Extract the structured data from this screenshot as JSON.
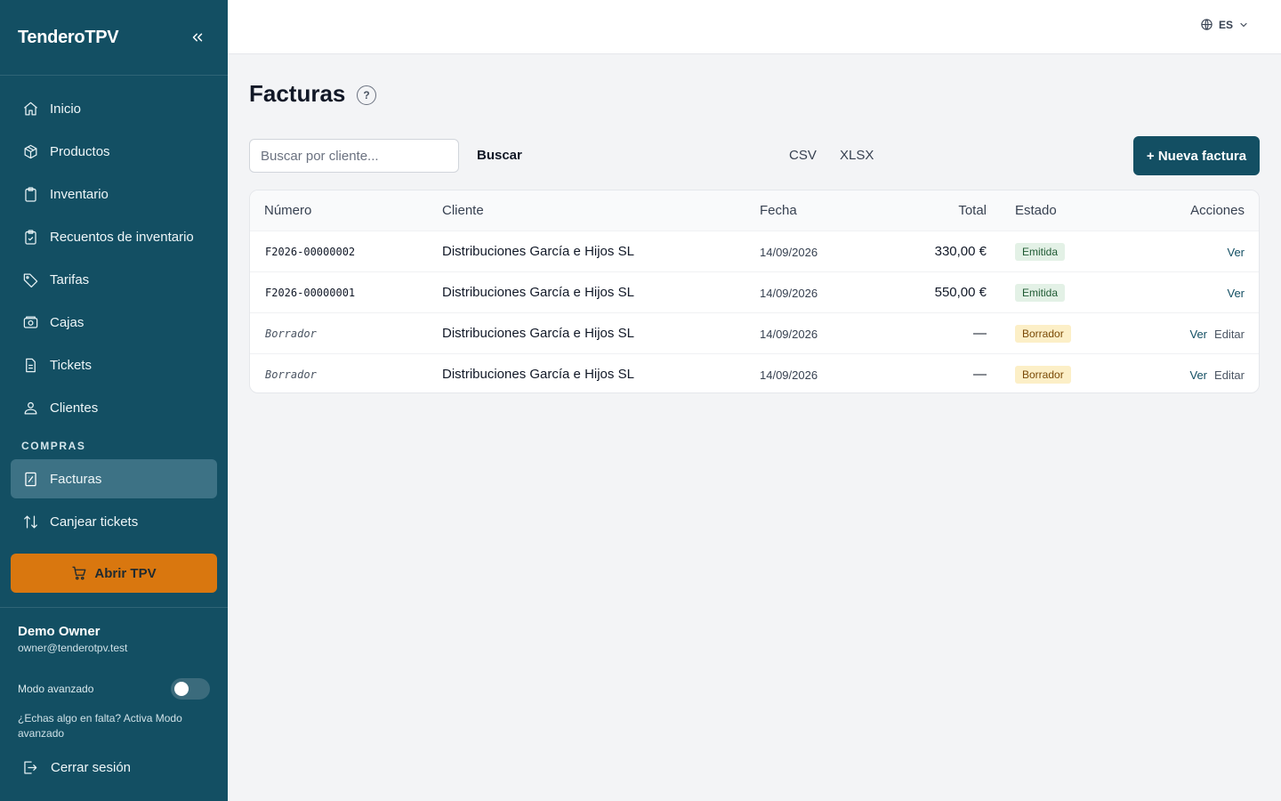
{
  "app": {
    "brand": "TenderoTPV",
    "language": "ES"
  },
  "sidebar": {
    "items": [
      {
        "label": "Inicio",
        "icon": "home-icon"
      },
      {
        "label": "Productos",
        "icon": "box-icon"
      },
      {
        "label": "Inventario",
        "icon": "clipboard-icon"
      },
      {
        "label": "Recuentos de inventario",
        "icon": "clipboard-check-icon"
      },
      {
        "label": "Tarifas",
        "icon": "tag-icon"
      },
      {
        "label": "Cajas",
        "icon": "cash-register-icon"
      },
      {
        "label": "Tickets",
        "icon": "document-icon"
      },
      {
        "label": "Clientes",
        "icon": "users-icon"
      }
    ],
    "section_label": "COMPRAS",
    "section_items": [
      {
        "label": "Facturas",
        "icon": "invoice-icon",
        "active": true
      },
      {
        "label": "Canjear tickets",
        "icon": "arrows-swap-icon"
      }
    ],
    "open_tpv": "Abrir TPV",
    "user": {
      "name": "Demo Owner",
      "email": "owner@tenderotpv.test"
    },
    "advanced_mode_label": "Modo avanzado",
    "advanced_mode_on": false,
    "advanced_hint": "¿Echas algo en falta? Activa Modo avanzado",
    "logout": "Cerrar sesión"
  },
  "main": {
    "title": "Facturas",
    "help_glyph": "?",
    "search_placeholder": "Buscar por cliente...",
    "search_button": "Buscar",
    "export_csv": "CSV",
    "export_xlsx": "XLSX",
    "new_invoice": "+ Nueva factura",
    "table": {
      "headers": {
        "number": "Número",
        "client": "Cliente",
        "date": "Fecha",
        "total": "Total",
        "status": "Estado",
        "actions": "Acciones"
      },
      "rows": [
        {
          "number": "F2026-00000002",
          "client": "Distribuciones García e Hijos SL",
          "date": "14/09/2026",
          "total": "330,00 €",
          "status": "Emitida",
          "view": "Ver",
          "edit": ""
        },
        {
          "number": "F2026-00000001",
          "client": "Distribuciones García e Hijos SL",
          "date": "14/09/2026",
          "total": "550,00 €",
          "status": "Emitida",
          "view": "Ver",
          "edit": ""
        },
        {
          "number": "Borrador",
          "client": "Distribuciones García e Hijos SL",
          "date": "14/09/2026",
          "total": "—",
          "status": "Borrador",
          "view": "Ver",
          "edit": "Editar"
        },
        {
          "number": "Borrador",
          "client": "Distribuciones García e Hijos SL",
          "date": "14/09/2026",
          "total": "—",
          "status": "Borrador",
          "view": "Ver",
          "edit": "Editar"
        }
      ]
    }
  },
  "colors": {
    "sidebar": "#134f63",
    "active_item": "#3d7285",
    "accent_orange": "#d9770f",
    "primary": "#134f63"
  }
}
